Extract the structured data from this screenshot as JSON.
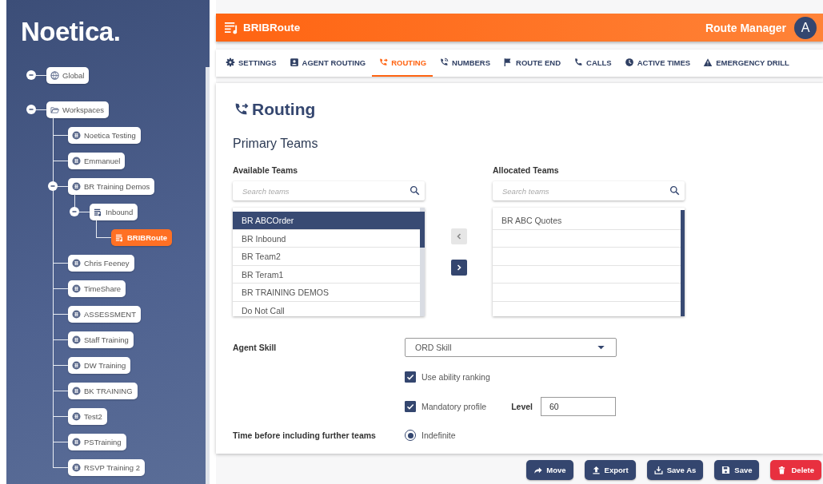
{
  "sidebar": {
    "logo": "Noetica.",
    "tree": [
      {
        "label": "Global",
        "kind": "global",
        "selected": false,
        "expanded": true
      },
      {
        "label": "Workspaces",
        "kind": "folder",
        "selected": false,
        "expanded": true,
        "children": [
          {
            "label": "Noetica Testing",
            "kind": "workspace",
            "selected": false
          },
          {
            "label": "Emmanuel",
            "kind": "workspace",
            "selected": false
          },
          {
            "label": "BR Training Demos",
            "kind": "workspace",
            "selected": false,
            "expanded": true,
            "children": [
              {
                "label": "Inbound",
                "kind": "route",
                "selected": false,
                "expanded": true,
                "children": [
                  {
                    "label": "BRIBRoute",
                    "kind": "route",
                    "selected": true
                  }
                ]
              }
            ]
          },
          {
            "label": "Chris Feeney",
            "kind": "workspace",
            "selected": false
          },
          {
            "label": "TimeShare",
            "kind": "workspace",
            "selected": false
          },
          {
            "label": "ASSESSMENT",
            "kind": "workspace",
            "selected": false
          },
          {
            "label": "Staff Training",
            "kind": "workspace",
            "selected": false
          },
          {
            "label": "DW Training",
            "kind": "workspace",
            "selected": false
          },
          {
            "label": "BK TRAINING",
            "kind": "workspace",
            "selected": false
          },
          {
            "label": "Test2",
            "kind": "workspace",
            "selected": false
          },
          {
            "label": "PSTraining",
            "kind": "workspace",
            "selected": false
          },
          {
            "label": "RSVP Training 2",
            "kind": "workspace",
            "selected": false
          }
        ]
      }
    ]
  },
  "header": {
    "title": "BRIBRoute",
    "app_name": "Route Manager",
    "avatar": "A"
  },
  "tabs": [
    {
      "label": "SETTINGS",
      "selected": false
    },
    {
      "label": "AGENT ROUTING",
      "selected": false
    },
    {
      "label": "ROUTING",
      "selected": true
    },
    {
      "label": "NUMBERS",
      "selected": false
    },
    {
      "label": "ROUTE END",
      "selected": false
    },
    {
      "label": "CALLS",
      "selected": false
    },
    {
      "label": "ACTIVE TIMES",
      "selected": false
    },
    {
      "label": "EMERGENCY DRILL",
      "selected": false
    }
  ],
  "content": {
    "title": "Routing",
    "section": "Primary Teams",
    "available": {
      "label": "Available Teams",
      "placeholder": "Search teams",
      "items": [
        {
          "name": "BR ABCOrder",
          "selected": true
        },
        {
          "name": "BR Inbound",
          "selected": false
        },
        {
          "name": "BR Team2",
          "selected": false
        },
        {
          "name": "BR Teram1",
          "selected": false
        },
        {
          "name": "BR TRAINING DEMOS",
          "selected": false
        },
        {
          "name": "Do Not Call",
          "selected": false
        }
      ]
    },
    "transfer": [
      {
        "kind": "left",
        "disabled": true
      },
      {
        "kind": "right",
        "disabled": false
      }
    ],
    "allocated": {
      "label": "Allocated Teams",
      "placeholder": "Search teams",
      "items": [
        {
          "name": "BR ABC Quotes",
          "selected": false
        }
      ]
    },
    "agent_skill": {
      "label": "Agent Skill",
      "value": "ORD Skill"
    },
    "options": [
      {
        "label": "Use ability ranking",
        "checked": true
      },
      {
        "label": "Mandatory profile",
        "checked": true
      }
    ],
    "level": {
      "label": "Level",
      "value": "60"
    },
    "time": {
      "label": "Time before including further teams",
      "options": [
        {
          "label": "Indefinite",
          "selected": true
        }
      ]
    }
  },
  "actions": [
    {
      "label": "Move",
      "kind": "move"
    },
    {
      "label": "Export",
      "kind": "export"
    },
    {
      "label": "Save As",
      "kind": "saveas"
    },
    {
      "label": "Save",
      "kind": "save"
    },
    {
      "label": "Delete",
      "kind": "delete"
    }
  ]
}
